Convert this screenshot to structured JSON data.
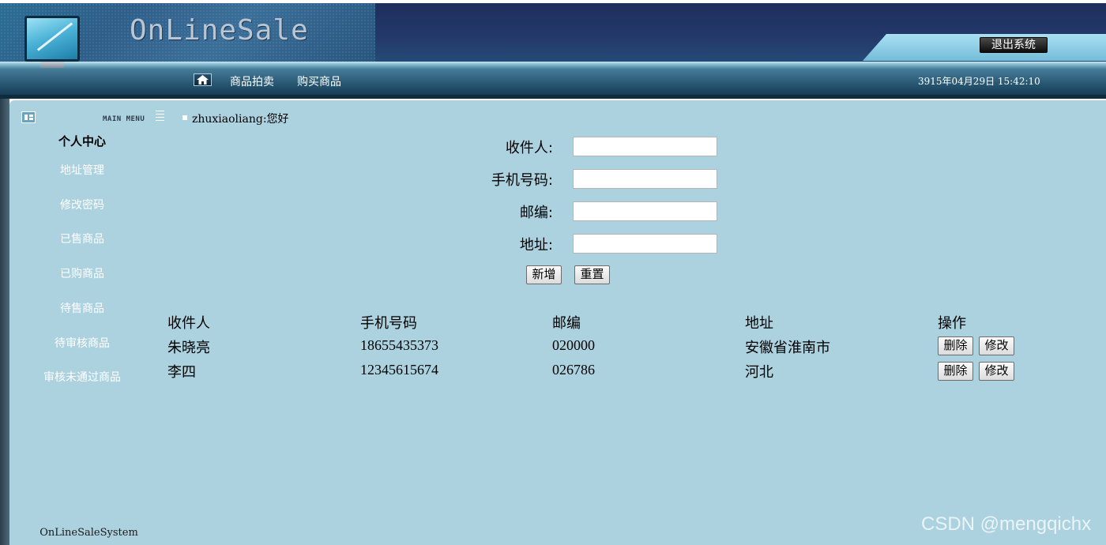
{
  "header": {
    "logo_text": "OnLineSale",
    "logout_label": "退出系统",
    "datetime": "3915年04月29日  15:42:10"
  },
  "nav": {
    "home_icon": "home-icon",
    "items": [
      {
        "label": "商品拍卖"
      },
      {
        "label": "购买商品"
      }
    ]
  },
  "sidebar": {
    "menu_label": "MAIN MENU",
    "heading": "个人中心",
    "items": [
      {
        "label": "地址管理"
      },
      {
        "label": "修改密码"
      },
      {
        "label": "已售商品"
      },
      {
        "label": "已购商品"
      },
      {
        "label": "待售商品"
      },
      {
        "label": "待审核商品"
      },
      {
        "label": "审核未通过商品"
      }
    ],
    "footer": "OnLineSaleSystem"
  },
  "greeting": "zhuxiaoliang:您好",
  "form": {
    "recipient_label": "收件人:",
    "recipient_value": "",
    "phone_label": "手机号码:",
    "phone_value": "",
    "zip_label": "邮编:",
    "zip_value": "",
    "address_label": "地址:",
    "address_value": "",
    "add_button": "新增",
    "reset_button": "重置"
  },
  "table": {
    "headers": [
      "收件人",
      "手机号码",
      "邮编",
      "地址",
      "操作"
    ],
    "rows": [
      {
        "recipient": "朱晓亮",
        "phone": "18655435373",
        "zip": "020000",
        "address": "安徽省淮南市",
        "delete": "删除",
        "edit": "修改"
      },
      {
        "recipient": "李四",
        "phone": "12345615674",
        "zip": "026786",
        "address": "河北",
        "delete": "删除",
        "edit": "修改"
      }
    ]
  },
  "watermark": "CSDN @mengqichx"
}
